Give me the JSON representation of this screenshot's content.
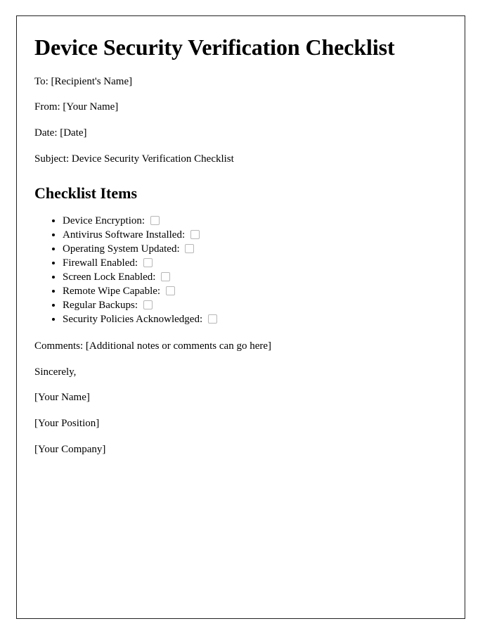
{
  "document": {
    "title": "Device Security Verification Checklist",
    "meta_lines": [
      "To: [Recipient's Name]",
      "From: [Your Name]",
      "Date: [Date]",
      "Subject: Device Security Verification Checklist"
    ],
    "section_heading": "Checklist Items",
    "checklist_items": [
      {
        "label": "Device Encryption:",
        "checked": false
      },
      {
        "label": "Antivirus Software Installed:",
        "checked": false
      },
      {
        "label": "Operating System Updated:",
        "checked": false
      },
      {
        "label": "Firewall Enabled:",
        "checked": false
      },
      {
        "label": "Screen Lock Enabled:",
        "checked": false
      },
      {
        "label": "Remote Wipe Capable:",
        "checked": false
      },
      {
        "label": "Regular Backups:",
        "checked": false
      },
      {
        "label": "Security Policies Acknowledged:",
        "checked": false
      }
    ],
    "comments_line": "Comments: [Additional notes or comments can go here]",
    "closing_lines": [
      "Sincerely,",
      "[Your Name]",
      "[Your Position]",
      "[Your Company]"
    ]
  },
  "style": {
    "page_background": "#ffffff",
    "text_color": "#000000",
    "border_color": "#222222",
    "checkbox_border_color": "#b8b8b8"
  }
}
